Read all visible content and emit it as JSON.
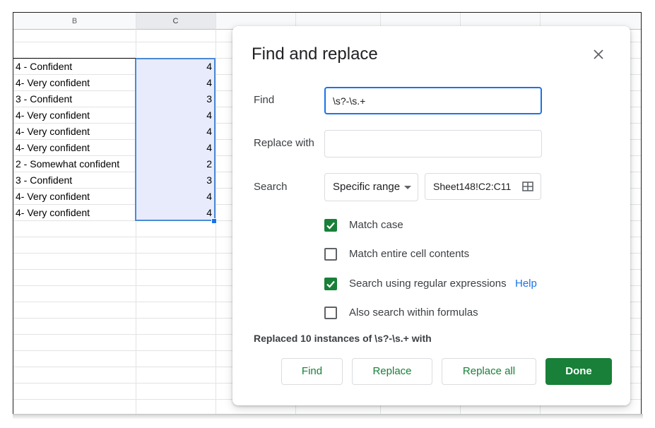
{
  "sheet": {
    "columns": [
      {
        "name": "B"
      },
      {
        "name": "C"
      }
    ],
    "rows": [
      {
        "b": "4 - Confident",
        "c": "4"
      },
      {
        "b": "4- Very confident",
        "c": "4"
      },
      {
        "b": "3 - Confident",
        "c": "3"
      },
      {
        "b": "4- Very confident",
        "c": "4"
      },
      {
        "b": "4- Very confident",
        "c": "4"
      },
      {
        "b": "4- Very confident",
        "c": "4"
      },
      {
        "b": "2 - Somewhat confident",
        "c": "2"
      },
      {
        "b": "3 - Confident",
        "c": "3"
      },
      {
        "b": "4- Very confident",
        "c": "4"
      },
      {
        "b": "4- Very confident",
        "c": "4"
      }
    ]
  },
  "dialog": {
    "title": "Find and replace",
    "find_label": "Find",
    "find_value": "\\s?-\\s.+",
    "replace_label": "Replace with",
    "replace_value": "",
    "search_label": "Search",
    "search_scope": "Specific range",
    "range_value": "Sheet148!C2:C11",
    "options": [
      {
        "label": "Match case",
        "checked": true
      },
      {
        "label": "Match entire cell contents",
        "checked": false
      },
      {
        "label": "Search using regular expressions",
        "checked": true
      },
      {
        "label": "Also search within formulas",
        "checked": false
      }
    ],
    "help_link": "Help",
    "status": "Replaced 10 instances of \\s?-\\s.+ with",
    "buttons": {
      "find": "Find",
      "replace": "Replace",
      "replace_all": "Replace all",
      "done": "Done"
    }
  },
  "colors": {
    "accent_green": "#188038",
    "focus_blue": "#1a73e8",
    "selection_fill": "#e7ebfb"
  }
}
